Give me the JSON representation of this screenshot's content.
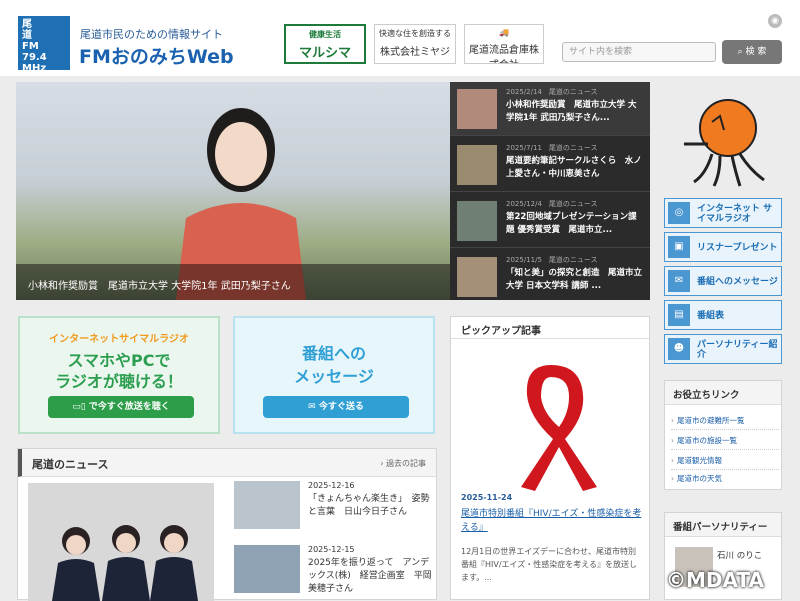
{
  "header": {
    "logo_lines": [
      "尾",
      "道",
      "FM",
      "79.4",
      "MHz"
    ],
    "tagline": "尾道市民のための情報サイト",
    "site_title": "FMおのみちWeb",
    "sponsors": [
      {
        "line1": "健康生活",
        "line2": "マルシマ"
      },
      {
        "line1": "快適な住を創造する",
        "line2": "株式会社ミヤジ"
      },
      {
        "line1": "",
        "line2": "尾道流品倉庫株式会社"
      }
    ],
    "search_placeholder": "サイト内を検索",
    "search_button": "検 索"
  },
  "hero": {
    "caption": "小林和作奨励賞　尾道市立大学 大学院1年 武田乃梨子さん"
  },
  "side_news": [
    {
      "date": "2025/2/14",
      "category": "尾道のニュース",
      "title": "小林和作奨励賞　尾道市立大学 大学院1年 武田乃梨子さん..."
    },
    {
      "date": "2025/7/11",
      "category": "尾道のニュース",
      "title": "尾道要約筆記サークルさくら　水ノ上愛さん・中川恵美さん"
    },
    {
      "date": "2025/12/4",
      "category": "尾道のニュース",
      "title": "第22回地域プレゼンテーション課題 優秀賞受賞　尾道市立..."
    },
    {
      "date": "2025/11/5",
      "category": "尾道のニュース",
      "title": "「知と美」の探究と創造　尾道市立大学 日本文学科 講師 ..."
    }
  ],
  "right_nav": [
    {
      "icon": "radio-icon",
      "glyph": "((•))",
      "label": "インターネット サイマルラジオ"
    },
    {
      "icon": "gift-icon",
      "glyph": "▣",
      "label": "リスナープレゼント"
    },
    {
      "icon": "mail-icon",
      "glyph": "✉",
      "label": "番組へのメッセージ"
    },
    {
      "icon": "schedule-icon",
      "glyph": "▤",
      "label": "番組表"
    },
    {
      "icon": "people-icon",
      "glyph": "☻",
      "label": "パーソナリティー紹介"
    }
  ],
  "banner_radio": {
    "top": "インターネットサイマルラジオ",
    "line1": "スマホやPCで",
    "line2": "ラジオが聴ける！",
    "button": "で今すぐ放送を聴く"
  },
  "banner_message": {
    "line1": "番組への",
    "line2": "メッセージ",
    "button": "今すぐ送る"
  },
  "news": {
    "title": "尾道のニュース",
    "archive": "過去の記事",
    "items": [
      {
        "date": "2025-12-16",
        "title": "「きょんちゃん楽生き」　姿勢と言葉　日山今日子さん"
      },
      {
        "date": "2025-12-15",
        "title": "2025年を振り返って　アンデックス(株)　経営企画室　平岡美穂子さん"
      }
    ]
  },
  "pickup": {
    "title": "ピックアップ記事",
    "date": "2025-11-24",
    "link": "尾道市特別番組『HIV/エイズ・性感染症を考える』",
    "desc": "12月1日の世界エイズデーに合わせ、尾道市特別番組『HIV/エイズ・性感染症を考える』を放送します。..."
  },
  "useful_links": {
    "title": "お役立ちリンク",
    "items": [
      "尾道市の避難所一覧",
      "尾道市の施設一覧",
      "尾道観光情報",
      "尾道市の天気"
    ]
  },
  "personality": {
    "title": "番組パーソナリティー",
    "name": "石川 のりこ"
  },
  "watermark": "©MDATA",
  "colors": {
    "brand_blue": "#1a62b0",
    "nav_blue": "#4a97d1",
    "green": "#2c9d48",
    "red_ribbon": "#d0171e"
  }
}
